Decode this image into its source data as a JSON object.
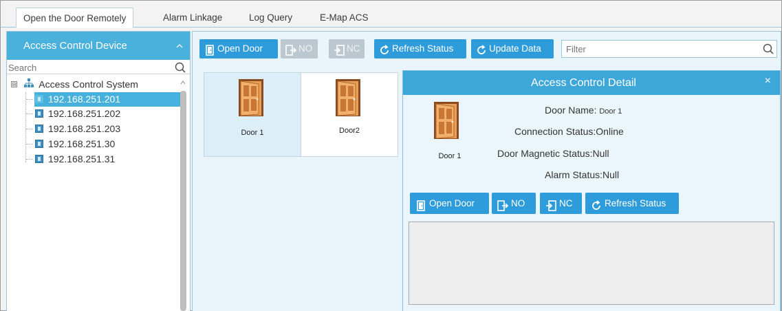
{
  "tabs": [
    {
      "label": "Open the Door Remotely",
      "active": true
    },
    {
      "label": "Alarm Linkage",
      "active": false
    },
    {
      "label": "Log Query",
      "active": false
    },
    {
      "label": "E-Map ACS",
      "active": false
    }
  ],
  "left_panel": {
    "title": "Access Control Device",
    "collapse_icon": "chevron-up",
    "search_placeholder": "Search",
    "tree": {
      "root_label": "Access Control System",
      "root_expander": "⊟",
      "nodes": [
        {
          "label": "192.168.251.201",
          "selected": true
        },
        {
          "label": "192.168.251.202",
          "selected": false
        },
        {
          "label": "192.168.251.203",
          "selected": false
        },
        {
          "label": "192.168.251.30",
          "selected": false
        },
        {
          "label": "192.168.251.31",
          "selected": false
        }
      ]
    }
  },
  "toolbar": {
    "open_door": "Open Door",
    "no": "NO",
    "nc": "NC",
    "refresh_status": "Refresh Status",
    "update_data": "Update Data",
    "filter_placeholder": "Filter"
  },
  "doors": [
    {
      "label": "Door 1",
      "selected": true
    },
    {
      "label": "Door2",
      "selected": false
    }
  ],
  "detail": {
    "title": "Access Control Detail",
    "close": "×",
    "door_label": "Door 1",
    "door_name_key": "Door Name:",
    "door_name_value": "Door 1",
    "connection_status_key": "Connection Status:",
    "connection_status_value": "Online",
    "door_magnetic_status_key": "Door Magnetic Status:",
    "door_magnetic_status_value": "Null",
    "alarm_status_key": "Alarm Status:",
    "alarm_status_value": "Null",
    "buttons": {
      "open_door": "Open Door",
      "no": "NO",
      "nc": "NC",
      "refresh_status": "Refresh Status"
    }
  },
  "colors": {
    "accent": "#2e9bdb",
    "header": "#4ab0dc",
    "disabled": "#bcc8d0"
  }
}
